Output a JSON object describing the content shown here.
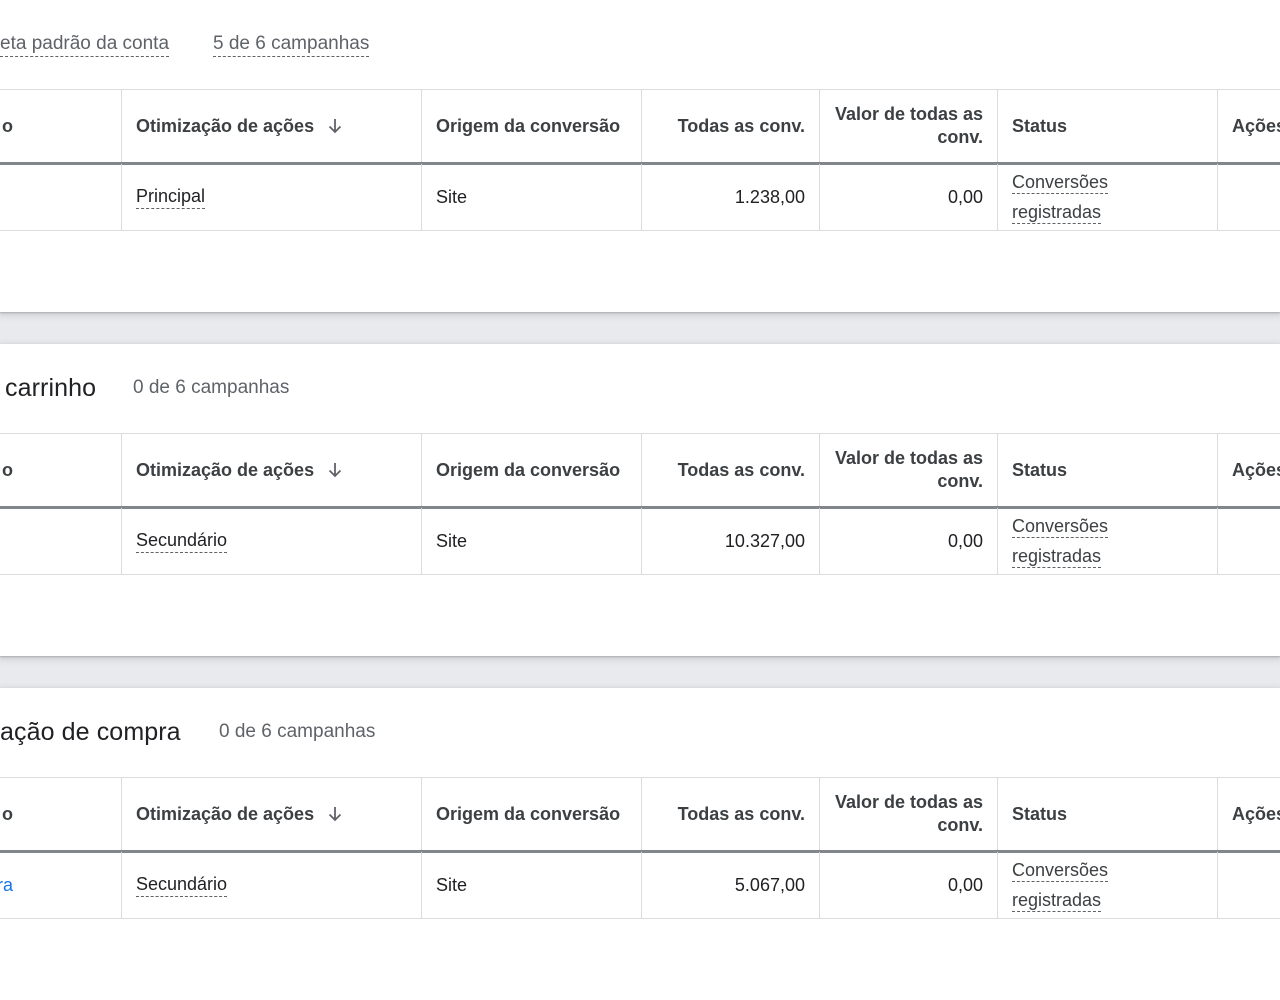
{
  "sections": [
    {
      "title": "",
      "goal_label": "eta padrão da conta",
      "campaigns": "5 de 6 campanhas",
      "headers": {
        "name": "o",
        "optimization": "Otimização de ações",
        "origin": "Origem da conversão",
        "all_conv": "Todas as conv.",
        "value": "Valor de todas as conv.",
        "status": "Status",
        "actions": "Ações"
      },
      "row": {
        "name": "",
        "optimization": "Principal",
        "origin": "Site",
        "all_conv": "1.238,00",
        "value": "0,00",
        "status_line1": "Conversões",
        "status_line2": "registradas"
      }
    },
    {
      "title": "carrinho",
      "campaigns": "0 de 6 campanhas",
      "headers": {
        "name": "o",
        "optimization": "Otimização de ações",
        "origin": "Origem da conversão",
        "all_conv": "Todas as conv.",
        "value": "Valor de todas as conv.",
        "status": "Status",
        "actions": "Ações"
      },
      "row": {
        "name": "",
        "optimization": "Secundário",
        "origin": "Site",
        "all_conv": "10.327,00",
        "value": "0,00",
        "status_line1": "Conversões",
        "status_line2": "registradas"
      }
    },
    {
      "title": "ação de compra",
      "campaigns": "0 de 6 campanhas",
      "headers": {
        "name": "o",
        "optimization": "Otimização de ações",
        "origin": "Origem da conversão",
        "all_conv": "Todas as conv.",
        "value": "Valor de todas as conv.",
        "status": "Status",
        "actions": "Ações"
      },
      "row": {
        "name": "mpra",
        "optimization": "Secundário",
        "origin": "Site",
        "all_conv": "5.067,00",
        "value": "0,00",
        "status_line1": "Conversões",
        "status_line2": "registradas"
      }
    }
  ],
  "icons": {
    "sort": "arrow-downward-icon"
  },
  "colors": {
    "link": "#1a73e8",
    "muted": "#5f6368",
    "divider": "#dadce0",
    "header_rule": "#80868b"
  }
}
